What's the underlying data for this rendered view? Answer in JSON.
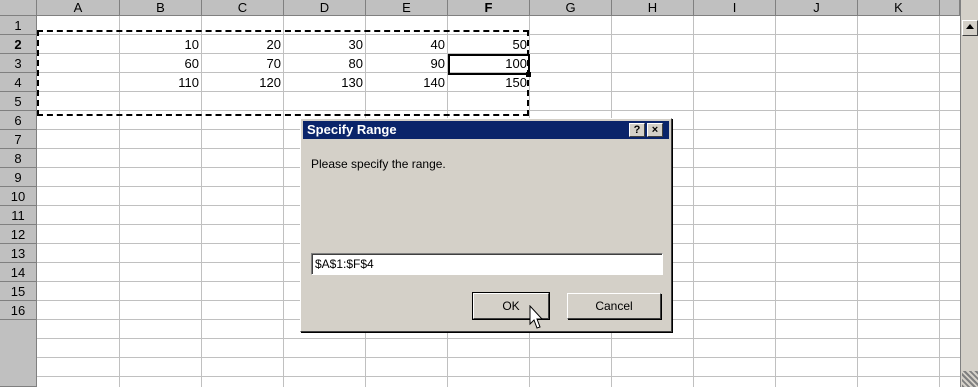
{
  "columns": [
    "A",
    "B",
    "C",
    "D",
    "E",
    "F",
    "G",
    "H",
    "I",
    "J",
    "K"
  ],
  "active_column": "F",
  "rows": [
    "1",
    "2",
    "3",
    "4",
    "5",
    "6",
    "7",
    "8",
    "9",
    "10",
    "11",
    "12",
    "13",
    "14",
    "15",
    "16"
  ],
  "active_row": "2",
  "cells": {
    "b2": "10",
    "c2": "20",
    "d2": "30",
    "e2": "40",
    "f2": "50",
    "b3": "60",
    "c3": "70",
    "d3": "80",
    "e3": "90",
    "f3": "100",
    "b4": "110",
    "c4": "120",
    "d4": "130",
    "e4": "140",
    "f4": "150"
  },
  "dialog": {
    "title": "Specify Range",
    "help_label": "?",
    "close_label": "×",
    "prompt": "Please specify the range.",
    "range_value": "$A$1:$F$4",
    "ok_label": "OK",
    "cancel_label": "Cancel"
  },
  "scrollbar": {
    "up_icon": "arrow-up-icon"
  }
}
